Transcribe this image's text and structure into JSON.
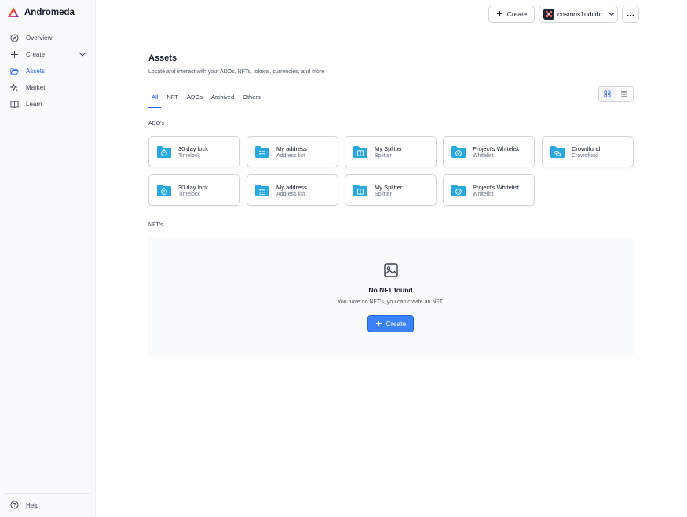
{
  "brand": {
    "name": "Andromeda"
  },
  "sidebar": {
    "items": [
      {
        "label": "Overview",
        "icon": "compass-icon",
        "active": false
      },
      {
        "label": "Create",
        "icon": "plus-icon",
        "active": false,
        "expandable": true
      },
      {
        "label": "Assets",
        "icon": "folder-icon",
        "active": true
      },
      {
        "label": "Market",
        "icon": "sparkles-icon",
        "active": false
      },
      {
        "label": "Learn",
        "icon": "book-icon",
        "active": false
      }
    ],
    "help_label": "Help"
  },
  "header": {
    "create_label": "Create",
    "wallet_label": "cosmos1udcdc..",
    "more_icon": "more-horizontal-icon"
  },
  "main": {
    "title": "Assets",
    "subtitle": "Locate and interact with your ADOs, NFTs, tokens, currencies, and more",
    "tabs": [
      {
        "label": "All",
        "active": true
      },
      {
        "label": "NFT",
        "active": false
      },
      {
        "label": "ADOs",
        "active": false
      },
      {
        "label": "Archived",
        "active": false
      },
      {
        "label": "Others",
        "active": false
      }
    ],
    "view": "grid",
    "ados_label": "ADO's",
    "ados": [
      {
        "name": "30 day lock",
        "type": "Timelock",
        "icon": "timer-icon"
      },
      {
        "name": "My address",
        "type": "Address list",
        "icon": "list-icon"
      },
      {
        "name": "My Splitter",
        "type": "Splitter",
        "icon": "split-icon"
      },
      {
        "name": "Project's Whitelist",
        "type": "Whitelist",
        "icon": "check-circle-icon"
      },
      {
        "name": "Crowdfund",
        "type": "Crowdfund",
        "icon": "coins-icon"
      },
      {
        "name": "30 day lock",
        "type": "Timelock",
        "icon": "timer-icon"
      },
      {
        "name": "My address",
        "type": "Address list",
        "icon": "list-icon"
      },
      {
        "name": "My Splitter",
        "type": "Splitter",
        "icon": "split-icon"
      },
      {
        "name": "Project's Whitelist",
        "type": "Whitelist",
        "icon": "check-circle-icon"
      }
    ],
    "nfts_label": "NFT's",
    "empty": {
      "title": "No NFT found",
      "description": "You have no NFT's, you can create an NFT.",
      "button_label": "Create"
    }
  },
  "colors": {
    "accent": "#2563eb",
    "folder": "#29a8df",
    "button_primary": "#3b82f6"
  }
}
